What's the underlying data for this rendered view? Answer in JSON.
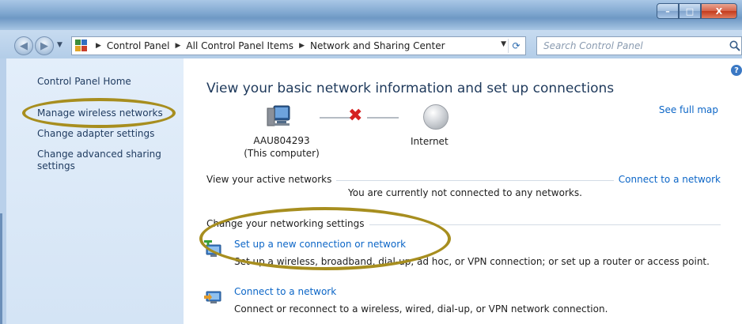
{
  "window": {
    "controls": {
      "minimize": "–",
      "maximize": "□",
      "close": "X"
    }
  },
  "nav": {
    "back_icon": "back-arrow-icon",
    "forward_icon": "forward-arrow-icon"
  },
  "address": {
    "breadcrumbs": [
      "Control Panel",
      "All Control Panel Items",
      "Network and Sharing Center"
    ]
  },
  "search": {
    "placeholder": "Search Control Panel"
  },
  "sidebar": {
    "items": [
      {
        "label": "Control Panel Home"
      },
      {
        "label": "Manage wireless networks"
      },
      {
        "label": "Change adapter settings"
      },
      {
        "label": "Change advanced sharing settings"
      }
    ]
  },
  "main": {
    "heading": "View your basic network information and set up connections",
    "see_full_map": "See full map",
    "computer_name": "AAU804293",
    "computer_sub": "(This computer)",
    "internet_label": "Internet",
    "active_networks_title": "View your active networks",
    "connect_link": "Connect to a network",
    "not_connected_text": "You are currently not connected to any networks.",
    "change_settings_title": "Change your networking settings",
    "tasks": [
      {
        "link": "Set up a new connection or network",
        "desc": "Set up a wireless, broadband, dial-up, ad hoc, or VPN connection; or set up a router or access point."
      },
      {
        "link": "Connect to a network",
        "desc": "Connect or reconnect to a wireless, wired, dial-up, or VPN network connection."
      }
    ]
  },
  "colors": {
    "annotation": "#a78e1f",
    "link": "#0c66c7",
    "heading": "#1e395b"
  }
}
